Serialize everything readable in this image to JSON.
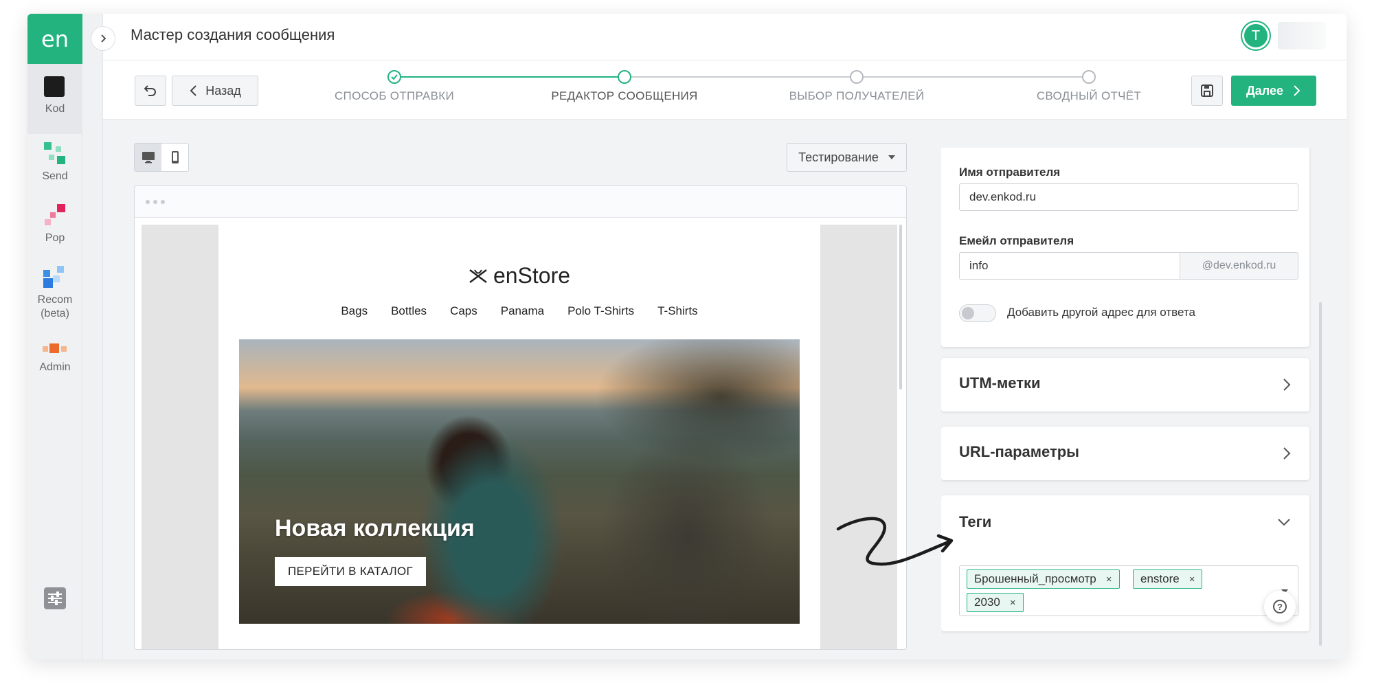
{
  "app": {
    "logo": "en",
    "title": "Мастер создания сообщения",
    "avatar_initial": "T"
  },
  "sidebar": {
    "items": [
      {
        "label": "Kod",
        "icon": "kod-square-icon"
      },
      {
        "label": "Send",
        "icon": "send-squares-icon"
      },
      {
        "label": "Pop",
        "icon": "pop-squares-icon"
      },
      {
        "label": "Recom\n(beta)",
        "icon": "recom-squares-icon"
      },
      {
        "label": "Admin",
        "icon": "admin-squares-icon"
      }
    ]
  },
  "wizard": {
    "back_label": "Назад",
    "next_label": "Далее",
    "steps": [
      {
        "label": "СПОСОБ ОТПРАВКИ",
        "state": "done"
      },
      {
        "label": "РЕДАКТОР СООБЩЕНИЯ",
        "state": "current"
      },
      {
        "label": "ВЫБОР ПОЛУЧАТЕЛЕЙ",
        "state": "pending"
      },
      {
        "label": "СВОДНЫЙ ОТЧЁТ",
        "state": "pending"
      }
    ]
  },
  "preview": {
    "testing_label": "Тестирование",
    "email": {
      "brand": "enStore",
      "menu": [
        "Bags",
        "Bottles",
        "Caps",
        "Panama",
        "Polo T-Shirts",
        "T-Shirts"
      ],
      "hero_title": "Новая коллекция",
      "hero_cta": "ПЕРЕЙТИ В КАТАЛОГ"
    }
  },
  "settings": {
    "sender_name_label": "Имя отправителя",
    "sender_name_value": "dev.enkod.ru",
    "sender_email_label": "Емейл отправителя",
    "sender_email_value": "info",
    "sender_email_domain": "@dev.enkod.ru",
    "reply_toggle_label": "Добавить другой адрес для ответа",
    "reply_toggle_on": false,
    "utm_title": "UTM-метки",
    "url_title": "URL-параметры",
    "tags_title": "Теги",
    "tags": [
      "Брошенный_просмотр",
      "enstore",
      "2030"
    ],
    "tag_remove": "×",
    "help": "?"
  },
  "colors": {
    "accent": "#22b37f",
    "background": "#f2f3f5"
  }
}
